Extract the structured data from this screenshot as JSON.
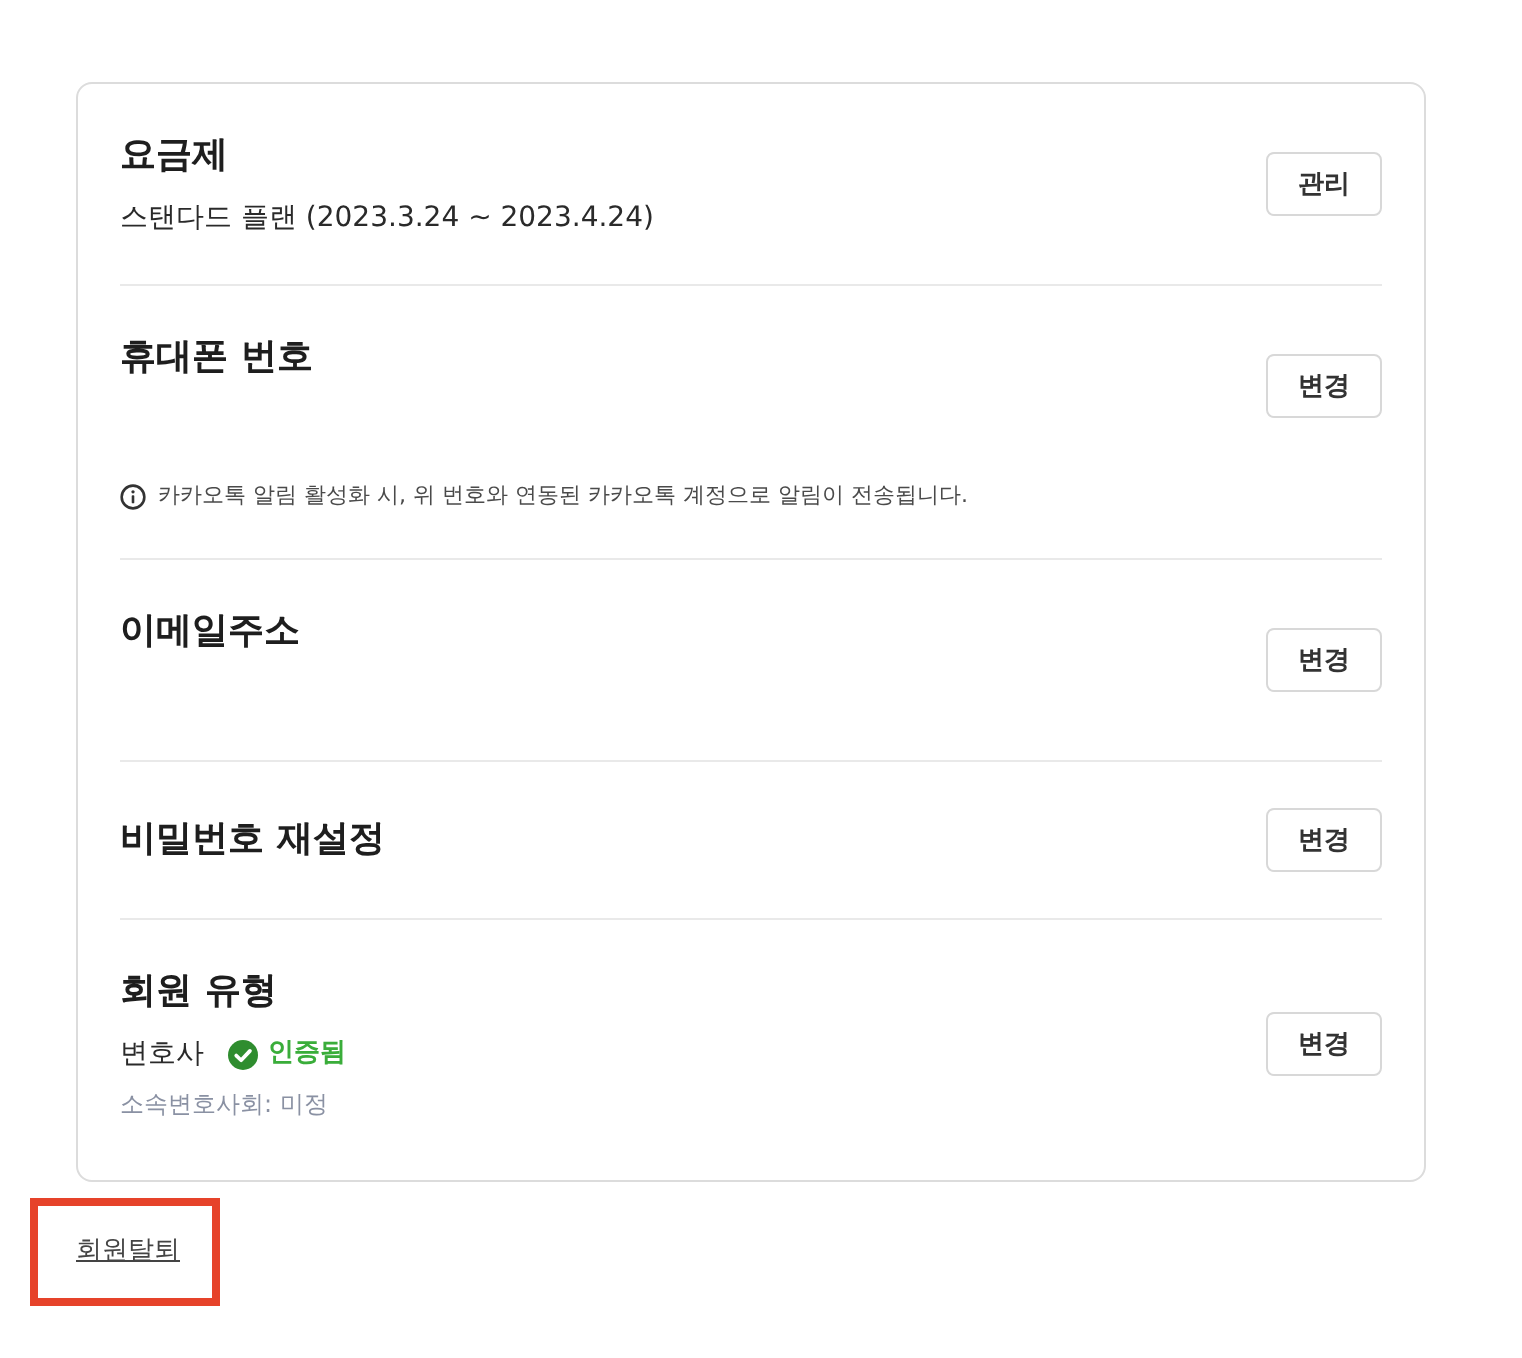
{
  "sections": [
    {
      "kind": "detail",
      "title": "요금제",
      "value": "스탠다드 플랜 (2023.3.24 ~ 2023.4.24)",
      "button": "관리"
    },
    {
      "kind": "detail",
      "title": "휴대폰 번호",
      "button": "변경",
      "note": "카카오톡 알림 활성화 시, 위 번호와 연동된 카카오톡 계정으로 알림이 전송됩니다."
    },
    {
      "kind": "detail",
      "title": "이메일주소",
      "button": "변경"
    },
    {
      "kind": "single",
      "title": "비밀번호 재설정",
      "button": "변경"
    },
    {
      "kind": "detail",
      "title": "회원 유형",
      "value": "변호사",
      "badge": {
        "verified": true,
        "label": "인증됨"
      },
      "sub": "소속변호사회: 미정",
      "button": "변경"
    }
  ],
  "withdraw_link": {
    "label": "회원탈퇴",
    "highlighted": true
  }
}
